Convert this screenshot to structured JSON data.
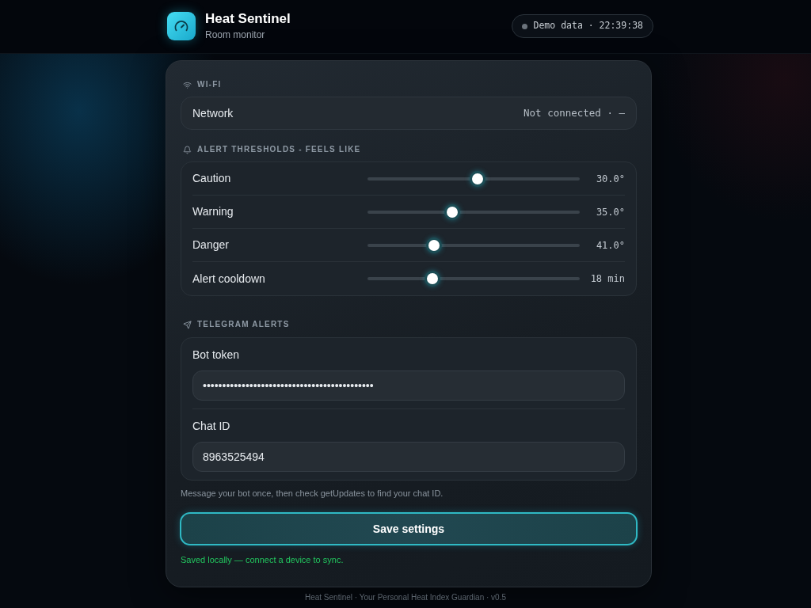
{
  "header": {
    "title": "Heat Sentinel",
    "subtitle": "Room monitor",
    "status": "Demo data · 22:39:38"
  },
  "wifi": {
    "heading": "WI-FI",
    "network": {
      "label": "Network",
      "value": "Not connected · –"
    }
  },
  "thresholds": {
    "heading": "ALERT THRESHOLDS - FEELS LIKE",
    "sliders": [
      {
        "label": "Caution",
        "level": 0.52,
        "reading": "30.0°"
      },
      {
        "label": "Warning",
        "level": 0.39,
        "reading": "35.0°"
      },
      {
        "label": "Danger",
        "level": 0.3,
        "reading": "41.0°"
      },
      {
        "label": "Alert cooldown",
        "level": 0.29,
        "reading": "18 min"
      }
    ]
  },
  "telegram": {
    "heading": "TELEGRAM ALERTS",
    "fields": [
      {
        "label": "Bot token",
        "value": "••••••••••••••••••••••••••••••••••••••••••••"
      },
      {
        "label": "Chat ID",
        "value": "8963525494"
      }
    ],
    "hint": "Message your bot once, then check getUpdates to find your chat ID."
  },
  "save_button": "Save settings",
  "save_status": "Saved locally — connect a device to sync.",
  "footer": "Heat Sentinel · Your Personal Heat Index Guardian · v0.5"
}
